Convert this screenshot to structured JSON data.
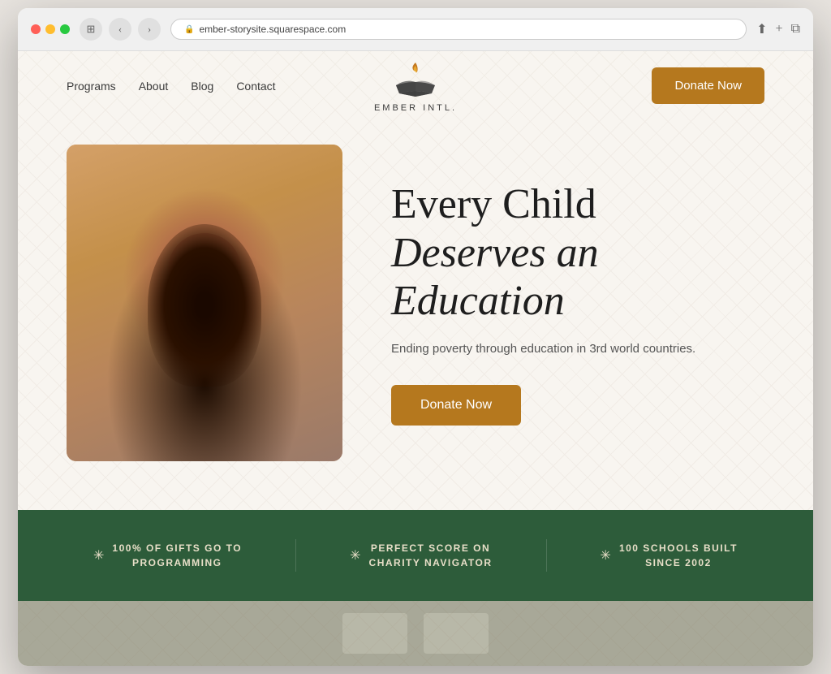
{
  "browser": {
    "url": "ember-storysite.squarespace.com",
    "nav": {
      "back": "‹",
      "forward": "›",
      "refresh": "↻"
    }
  },
  "nav": {
    "links": [
      {
        "label": "Programs",
        "id": "programs"
      },
      {
        "label": "About",
        "id": "about"
      },
      {
        "label": "Blog",
        "id": "blog"
      },
      {
        "label": "Contact",
        "id": "contact"
      }
    ],
    "donate_label": "Donate Now"
  },
  "logo": {
    "name": "EMBER INTL.",
    "tagline": "EMBER INTL."
  },
  "hero": {
    "title_line1": "Every Child",
    "title_line2": "Deserves an",
    "title_line3": "Education",
    "subtitle": "Ending poverty through education in 3rd world countries.",
    "cta_label": "Donate Now"
  },
  "stats": [
    {
      "icon": "✳",
      "text": "100% OF GIFTS GO TO\nPROGRAMMING"
    },
    {
      "icon": "✳",
      "text": "PERFECT SCORE ON\nCHARITY NAVIGATOR"
    },
    {
      "icon": "✳",
      "text": "100 SCHOOLS BUILT\nSINCE 2002"
    }
  ],
  "colors": {
    "donate_btn": "#b5781e",
    "stats_bg": "#2d5c3a",
    "hero_bg": "#f8f5f0"
  }
}
